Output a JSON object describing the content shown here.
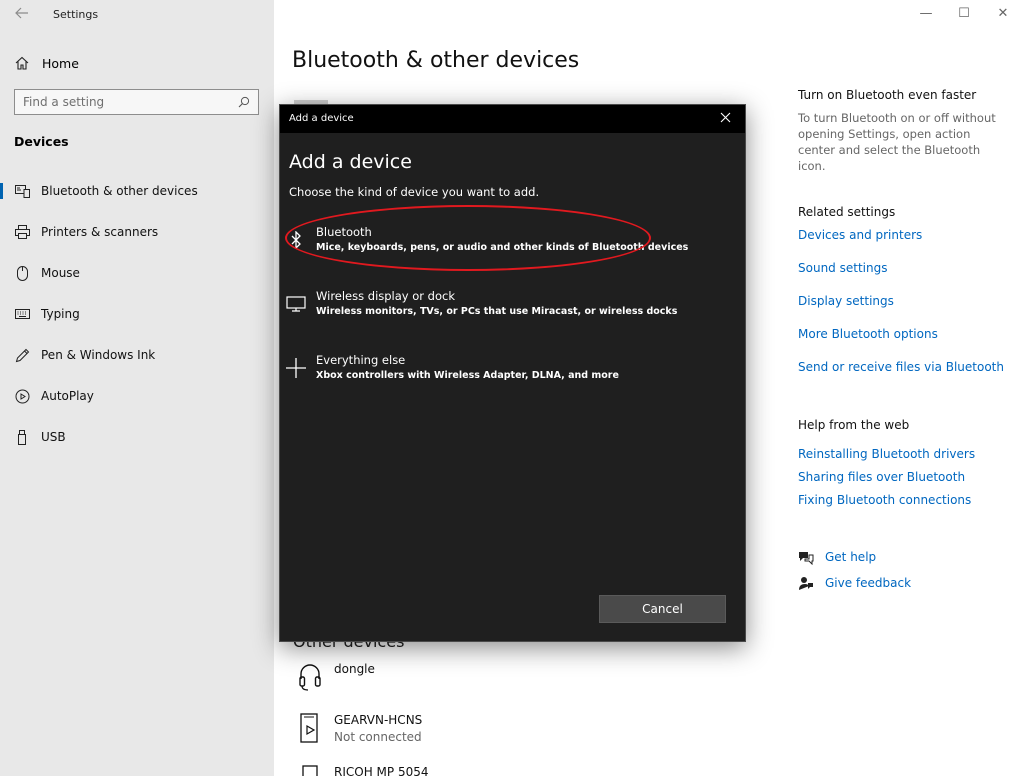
{
  "window": {
    "title": "Settings",
    "back_icon": "back-arrow-icon",
    "minimize": "—",
    "maximize": "☐",
    "close": "✕"
  },
  "sidebar": {
    "home_label": "Home",
    "search_placeholder": "Find a setting",
    "section_title": "Devices",
    "items": [
      {
        "label": "Bluetooth & other devices",
        "icon": "bluetooth-devices-icon",
        "active": true
      },
      {
        "label": "Printers & scanners",
        "icon": "printer-icon",
        "active": false
      },
      {
        "label": "Mouse",
        "icon": "mouse-icon",
        "active": false
      },
      {
        "label": "Typing",
        "icon": "keyboard-icon",
        "active": false
      },
      {
        "label": "Pen & Windows Ink",
        "icon": "pen-icon",
        "active": false
      },
      {
        "label": "AutoPlay",
        "icon": "autoplay-icon",
        "active": false
      },
      {
        "label": "USB",
        "icon": "usb-icon",
        "active": false
      }
    ]
  },
  "main": {
    "title": "Bluetooth & other devices",
    "other_devices_title": "Other devices",
    "devices": [
      {
        "name": "dongle",
        "status": "",
        "icon": "headset-icon"
      },
      {
        "name": "GEARVN-HCNS",
        "status": "Not connected",
        "icon": "media-device-icon"
      },
      {
        "name": "RICOH MP 5054",
        "status": "",
        "icon": "printer-device-icon"
      }
    ]
  },
  "right": {
    "tip_heading": "Turn on Bluetooth even faster",
    "tip_text": "To turn Bluetooth on or off without opening Settings, open action center and select the Bluetooth icon.",
    "related_heading": "Related settings",
    "related_links": [
      "Devices and printers",
      "Sound settings",
      "Display settings",
      "More Bluetooth options",
      "Send or receive files via Bluetooth"
    ],
    "help_heading": "Help from the web",
    "help_links": [
      "Reinstalling Bluetooth drivers",
      "Sharing files over Bluetooth",
      "Fixing Bluetooth connections"
    ],
    "get_help": "Get help",
    "give_feedback": "Give feedback"
  },
  "dialog": {
    "titlebar": "Add a device",
    "heading": "Add a device",
    "subtitle": "Choose the kind of device you want to add.",
    "options": [
      {
        "title": "Bluetooth",
        "desc": "Mice, keyboards, pens, or audio and other kinds of Bluetooth devices",
        "icon": "bluetooth-icon"
      },
      {
        "title": "Wireless display or dock",
        "desc": "Wireless monitors, TVs, or PCs that use Miracast, or wireless docks",
        "icon": "monitor-icon"
      },
      {
        "title": "Everything else",
        "desc": "Xbox controllers with Wireless Adapter, DLNA, and more",
        "icon": "plus-icon"
      }
    ],
    "cancel_label": "Cancel"
  },
  "colors": {
    "accent": "#0063b1",
    "link": "#0067c0",
    "annotation": "#e1191f",
    "dialog_bg": "#1f1f1f"
  }
}
